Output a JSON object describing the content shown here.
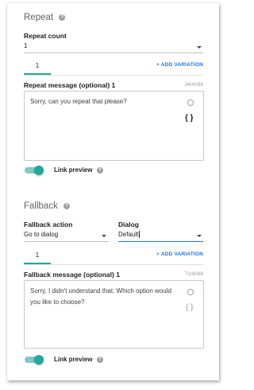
{
  "repeat": {
    "title": "Repeat",
    "count_label": "Repeat count",
    "count_value": "1",
    "tab_label": "1",
    "add_variation": "+ ADD VARIATION",
    "message_label": "Repeat message (optional) 1",
    "counter": "34/4096",
    "message": "Sorry, can you repeat that please?",
    "braces": "{ }",
    "link_preview": "Link preview"
  },
  "fallback": {
    "title": "Fallback",
    "action_label": "Fallback action",
    "action_value": "Go to dialog",
    "dialog_label": "Dialog",
    "dialog_value": "Default",
    "tab_label": "1",
    "add_variation": "+ ADD VARIATION",
    "message_label": "Fallback message (optional) 1",
    "counter": "71/4096",
    "message": "Sorry, I didn't understand that. Which option would you like to choose?",
    "braces": "{ }",
    "link_preview": "Link preview"
  },
  "colors": {
    "accent": "#26a69a",
    "link": "#1a73e8"
  },
  "icons": [
    "help-icon",
    "dropdown-caret-icon",
    "emoji-icon",
    "variable-braces-icon",
    "toggle-switch"
  ]
}
